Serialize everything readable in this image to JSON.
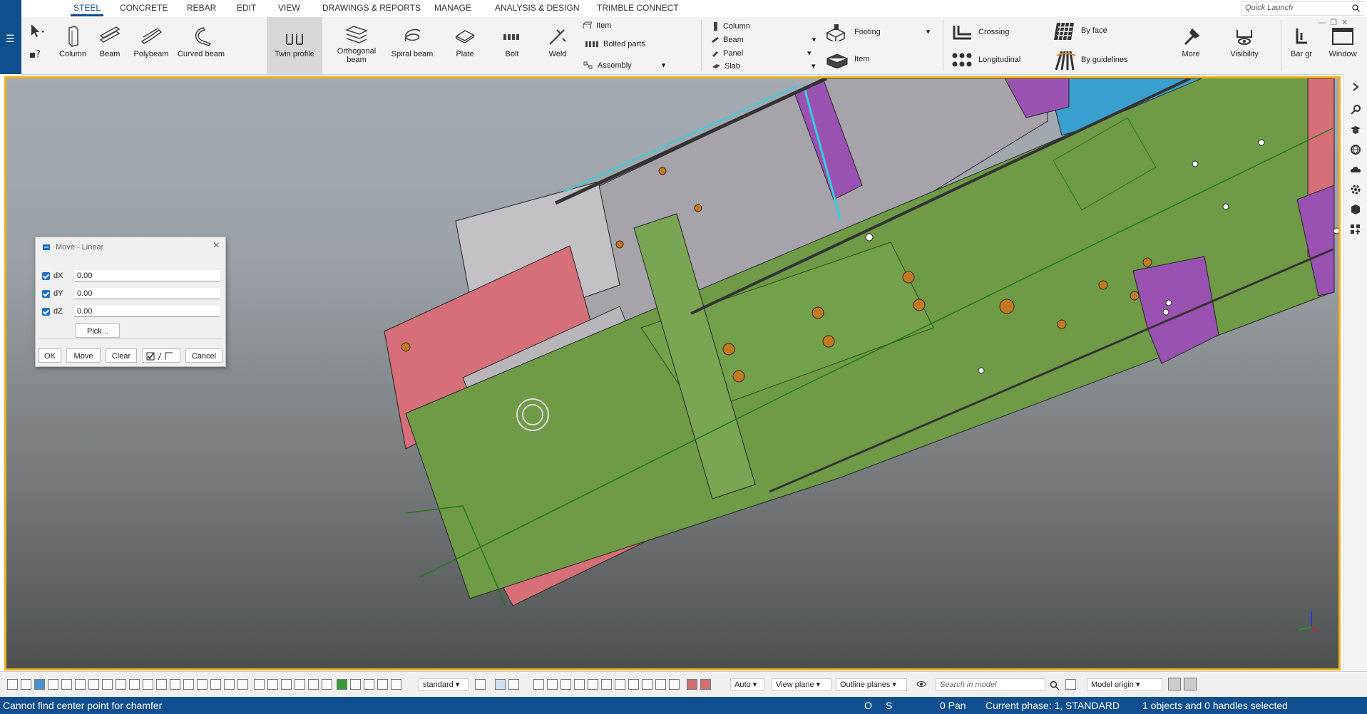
{
  "ribbon": {
    "tabs": [
      "STEEL",
      "CONCRETE",
      "REBAR",
      "EDIT",
      "VIEW",
      "DRAWINGS & REPORTS",
      "MANAGE",
      "ANALYSIS & DESIGN",
      "TRIMBLE CONNECT"
    ],
    "active_tab": "STEEL",
    "steel_buttons": [
      "Column",
      "Beam",
      "Polybeam",
      "Curved beam",
      "Twin profile"
    ],
    "orthogonal_beam": [
      "Orthogonal",
      "beam"
    ],
    "spiral_beam": "Spiral beam",
    "plate": "Plate",
    "bolt": "Bolt",
    "weld": "Weld",
    "item": "Item",
    "bolted_parts": "Bolted parts",
    "assembly": "Assembly",
    "concrete_small": [
      "Column",
      "Beam",
      "Panel",
      "Slab"
    ],
    "footing": "Footing",
    "concrete_item": "Item",
    "crossing": "Crossing",
    "longitudinal": "Longitudinal",
    "by_face": "By face",
    "by_guidelines": "By guidelines",
    "more": "More",
    "visibility": "Visibility",
    "bar_group": "Bar gr",
    "window": "Window",
    "quick_launch_placeholder": "Quick Launch",
    "selected_button": "Twin profile"
  },
  "dialog": {
    "title": "Move - Linear",
    "fields": [
      {
        "label": "dX",
        "value": "0.00",
        "checked": true
      },
      {
        "label": "dY",
        "value": "0.00",
        "checked": true
      },
      {
        "label": "dZ",
        "value": "0.00",
        "checked": true
      }
    ],
    "pick": "Pick...",
    "buttons": {
      "ok": "OK",
      "move": "Move",
      "clear": "Clear",
      "cancel": "Cancel"
    }
  },
  "bottombar": {
    "view_setting": "standard",
    "auto": "Auto",
    "view_plane": "View plane",
    "outline_planes": "Outline planes",
    "search_placeholder": "Search in model",
    "model_origin": "Model origin"
  },
  "status": {
    "message": "Cannot find center point for chamfer",
    "o": "O",
    "s": "S",
    "pan": "0  Pan",
    "phase": "Current phase: 1, STANDARD",
    "selection": "1 objects and 0 handles selected"
  },
  "colors": {
    "brand_blue": "#0f4f8f",
    "viewport_border": "#f0b020",
    "green_part": "#6f9a46",
    "pink_part": "#d66f78",
    "purple_part": "#9a52b2",
    "cyan_part": "#3aa0d0"
  }
}
